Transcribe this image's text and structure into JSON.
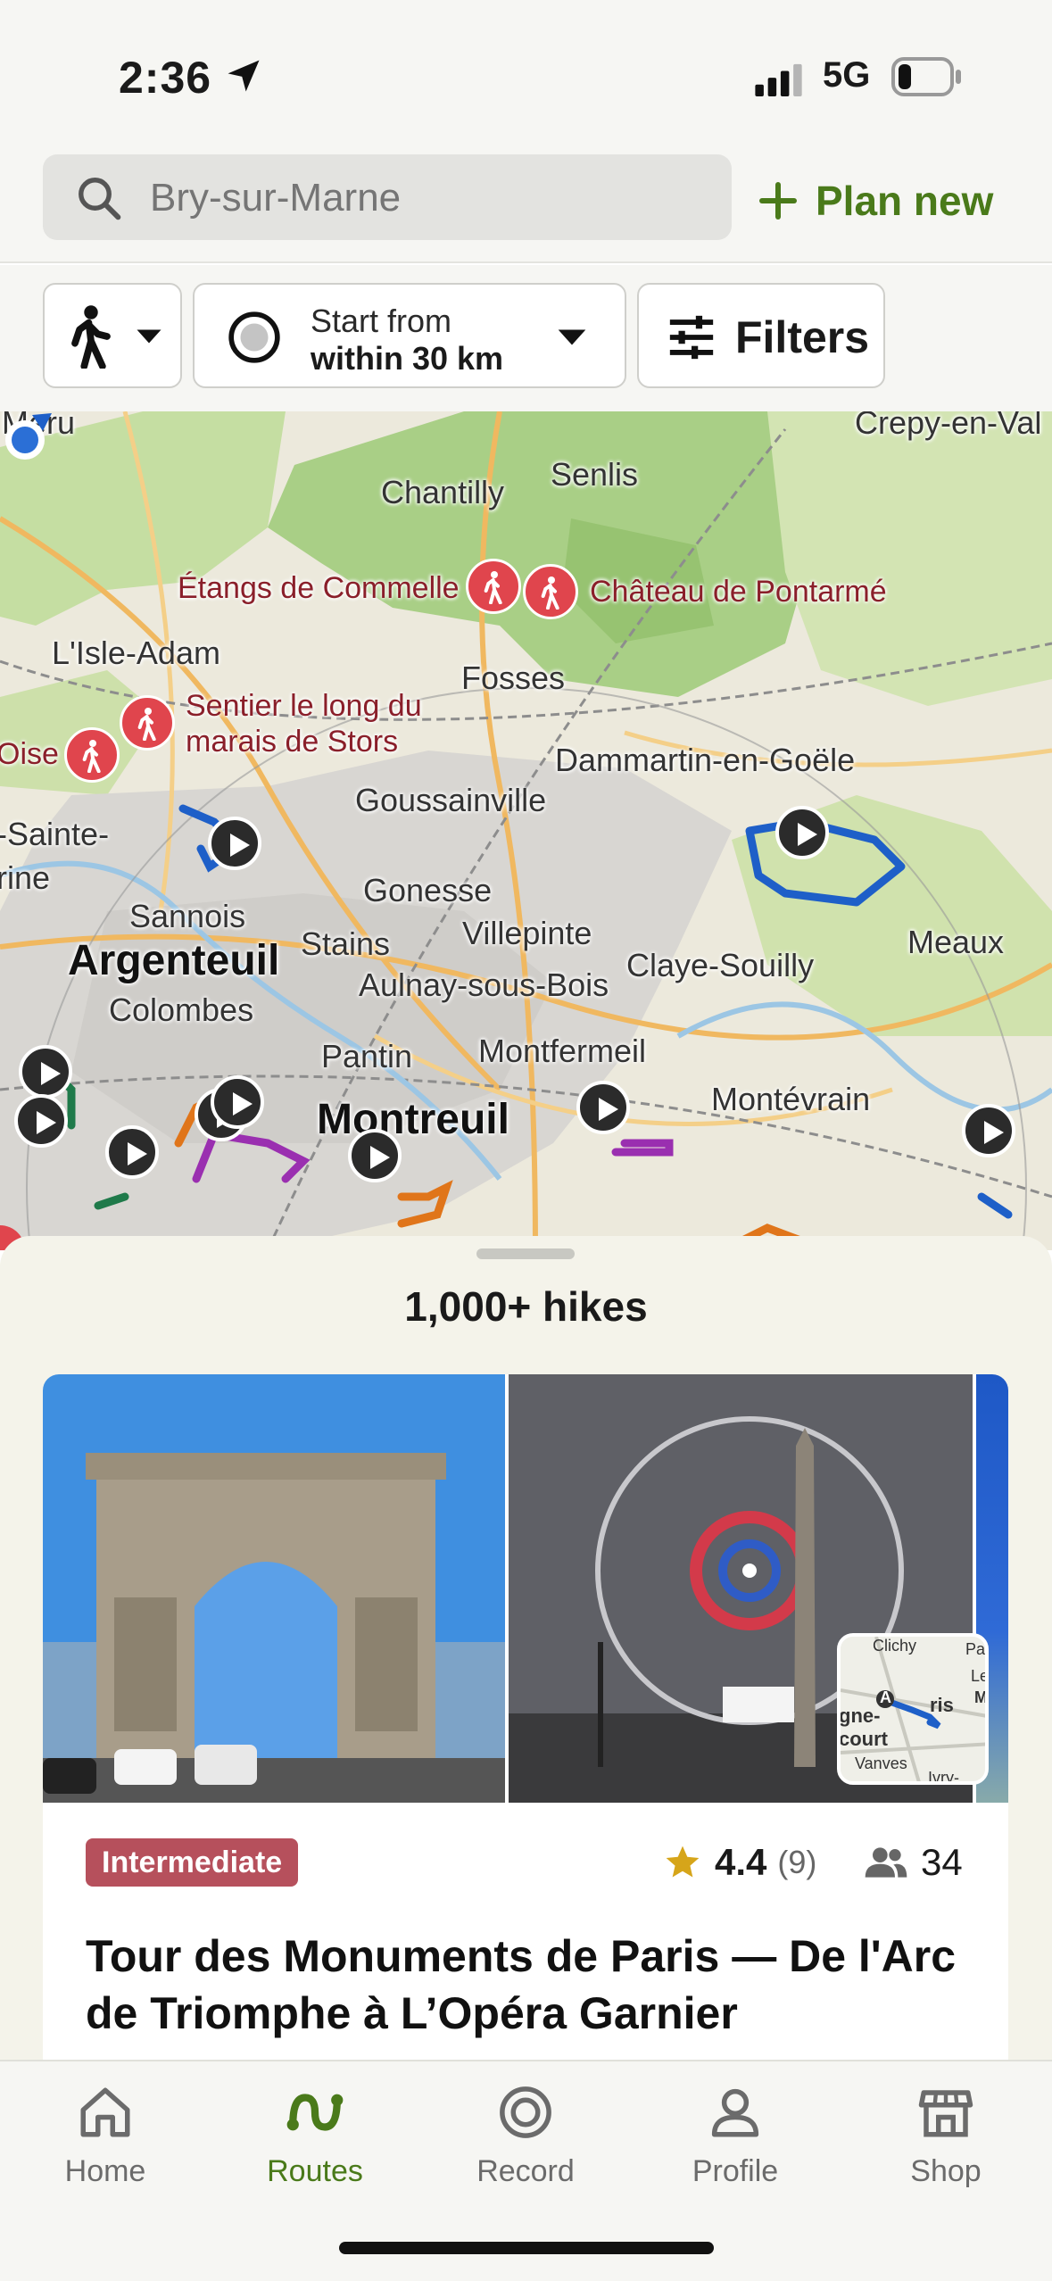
{
  "status_bar": {
    "time": "2:36",
    "network": "5G"
  },
  "search": {
    "placeholder": "Bry-sur-Marne"
  },
  "header": {
    "plan_new_label": "Plan new"
  },
  "filters": {
    "start_line1": "Start from",
    "start_line2": "within 30 km",
    "filters_label": "Filters"
  },
  "map": {
    "places": [
      "Chantilly",
      "Senlis",
      "Crepy-en-Val",
      "L'Isle-Adam",
      "Fosses",
      "Dammartin-en-Goële",
      "Goussainville",
      "Oise",
      "-Sainte-",
      "rine",
      "Sannois",
      "Gonesse",
      "Stains",
      "Villepinte",
      "Claye-Souilly",
      "Meaux",
      "Colombes",
      "Aulnay-sous-Bois",
      "Pantin",
      "Montfermeil",
      "Montévrain",
      "Meru"
    ],
    "major_places": [
      "Argenteuil",
      "Montreuil"
    ],
    "pois": [
      "Étangs de Commelle",
      "Château de Pontarmé",
      "Sentier le long du",
      "marais de Stors"
    ]
  },
  "sheet": {
    "count": "1,000+ hikes",
    "card": {
      "difficulty": "Intermediate",
      "rating": "4.4",
      "rating_count": "(9)",
      "people_count": "34",
      "title": "Tour des Monuments de Paris — De l'Arc de Triomphe à L’Opéra Garnier",
      "minimap_labels": [
        "Clichy",
        "Pai",
        "Le",
        "ris",
        "gne-",
        "court",
        "Vanves",
        "Ivry-sur-",
        "A",
        "M"
      ]
    }
  },
  "tabbar": {
    "tabs": [
      {
        "label": "Home",
        "icon": "home-icon"
      },
      {
        "label": "Routes",
        "icon": "routes-icon"
      },
      {
        "label": "Record",
        "icon": "record-icon"
      },
      {
        "label": "Profile",
        "icon": "profile-icon"
      },
      {
        "label": "Shop",
        "icon": "shop-icon"
      }
    ],
    "active": "Routes"
  },
  "colors": {
    "accent": "#4a7a1a",
    "difficulty_badge": "#b6505c",
    "poi_pin": "#e0454d",
    "background": "#f6f6f3"
  }
}
